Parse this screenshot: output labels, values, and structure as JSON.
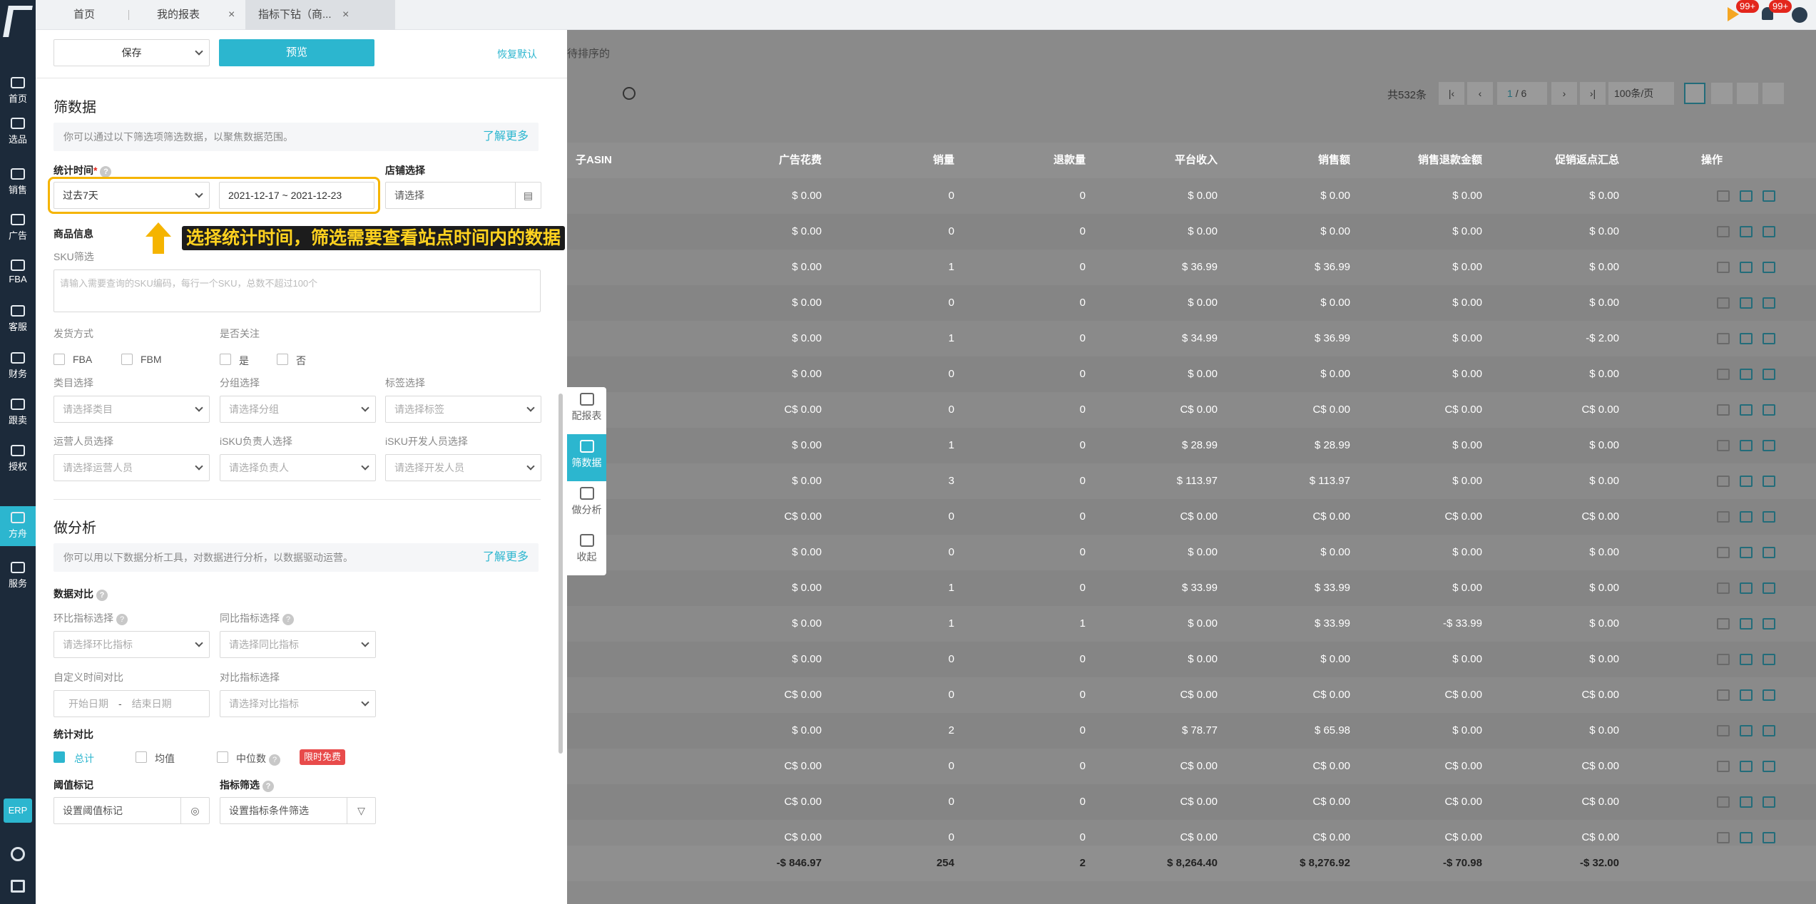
{
  "nav": {
    "items": [
      {
        "label": "首页"
      },
      {
        "label": "选品"
      },
      {
        "label": "销售"
      },
      {
        "label": "广告"
      },
      {
        "label": "FBA"
      },
      {
        "label": "客服"
      },
      {
        "label": "财务"
      },
      {
        "label": "跟卖"
      },
      {
        "label": "授权"
      },
      {
        "label": "方舟"
      },
      {
        "label": "服务"
      }
    ],
    "erp": "ERP"
  },
  "tabs": [
    {
      "label": "首页"
    },
    {
      "label": "我的报表"
    },
    {
      "label": "指标下钻（商..."
    }
  ],
  "badges": [
    "99+",
    "99+"
  ],
  "panel": {
    "save": "保存",
    "preview": "预览",
    "reset": "恢复默认",
    "filter": {
      "title": "筛数据",
      "note": "你可以通过以下筛选项筛选数据，以聚焦数据范围。",
      "more": "了解更多",
      "stat_time_label": "统计时间",
      "stat_time_value": "过去7天",
      "date_range": "2021-12-17  ~  2021-12-23",
      "shop_label": "店铺选择",
      "shop_placeholder": "请选择",
      "product_label": "商品信息",
      "sku_label": "SKU筛选",
      "sku_placeholder": "请输入需要查询的SKU编码，每行一个SKU，总数不超过100个",
      "ship_label": "发货方式",
      "fba": "FBA",
      "fbm": "FBM",
      "follow_label": "是否关注",
      "yes": "是",
      "no": "否",
      "cat_label": "类目选择",
      "cat_ph": "请选择类目",
      "group_label": "分组选择",
      "group_ph": "请选择分组",
      "tag_label": "标签选择",
      "tag_ph": "请选择标签",
      "ops_label": "运营人员选择",
      "ops_ph": "请选择运营人员",
      "owner_label": "iSKU负责人选择",
      "owner_ph": "请选择负责人",
      "dev_label": "iSKU开发人员选择",
      "dev_ph": "请选择开发人员"
    },
    "analysis": {
      "title": "做分析",
      "note": "你可以用以下数据分析工具，对数据进行分析，以数据驱动运营。",
      "more": "了解更多",
      "compare_label": "数据对比",
      "mom_label": "环比指标选择",
      "mom_ph": "请选择环比指标",
      "yoy_label": "同比指标选择",
      "yoy_ph": "请选择同比指标",
      "custom_label": "自定义时间对比",
      "start_ph": "开始日期",
      "end_ph": "结束日期",
      "cmp_label": "对比指标选择",
      "cmp_ph": "请选择对比指标",
      "stat_cmp_label": "统计对比",
      "total": "总计",
      "mean": "均值",
      "median": "中位数",
      "free_tag": "限时免费",
      "threshold_label": "阈值标记",
      "threshold_ph": "设置阈值标记",
      "metric_filter_label": "指标筛选",
      "metric_filter_ph": "设置指标条件筛选"
    }
  },
  "annotation": "选择统计时间，筛选需要查看站点时间内的数据",
  "rail": [
    {
      "label": "配报表"
    },
    {
      "label": "筛数据"
    },
    {
      "label": "做分析"
    },
    {
      "label": "收起"
    }
  ],
  "table": {
    "sort_hint": "待排序的",
    "total_label": "共532条",
    "page_current": "1",
    "page_total": "/ 6",
    "page_size": "100条/页",
    "headers": [
      "子ASIN",
      "广告花费",
      "销量",
      "退款量",
      "平台收入",
      "销售额",
      "销售退款金额",
      "促销返点汇总",
      "操作"
    ],
    "rows": [
      [
        "$ 0.00",
        "0",
        "0",
        "$ 0.00",
        "$ 0.00",
        "$ 0.00",
        "$ 0.00"
      ],
      [
        "$ 0.00",
        "0",
        "0",
        "$ 0.00",
        "$ 0.00",
        "$ 0.00",
        "$ 0.00"
      ],
      [
        "$ 0.00",
        "1",
        "0",
        "$ 36.99",
        "$ 36.99",
        "$ 0.00",
        "$ 0.00"
      ],
      [
        "$ 0.00",
        "0",
        "0",
        "$ 0.00",
        "$ 0.00",
        "$ 0.00",
        "$ 0.00"
      ],
      [
        "$ 0.00",
        "1",
        "0",
        "$ 34.99",
        "$ 36.99",
        "$ 0.00",
        "-$ 2.00"
      ],
      [
        "$ 0.00",
        "0",
        "0",
        "$ 0.00",
        "$ 0.00",
        "$ 0.00",
        "$ 0.00"
      ],
      [
        "C$ 0.00",
        "0",
        "0",
        "C$ 0.00",
        "C$ 0.00",
        "C$ 0.00",
        "C$ 0.00"
      ],
      [
        "$ 0.00",
        "1",
        "0",
        "$ 28.99",
        "$ 28.99",
        "$ 0.00",
        "$ 0.00"
      ],
      [
        "$ 0.00",
        "3",
        "0",
        "$ 113.97",
        "$ 113.97",
        "$ 0.00",
        "$ 0.00"
      ],
      [
        "C$ 0.00",
        "0",
        "0",
        "C$ 0.00",
        "C$ 0.00",
        "C$ 0.00",
        "C$ 0.00"
      ],
      [
        "$ 0.00",
        "0",
        "0",
        "$ 0.00",
        "$ 0.00",
        "$ 0.00",
        "$ 0.00"
      ],
      [
        "$ 0.00",
        "1",
        "0",
        "$ 33.99",
        "$ 33.99",
        "$ 0.00",
        "$ 0.00"
      ],
      [
        "$ 0.00",
        "1",
        "1",
        "$ 0.00",
        "$ 33.99",
        "-$ 33.99",
        "$ 0.00"
      ],
      [
        "$ 0.00",
        "0",
        "0",
        "$ 0.00",
        "$ 0.00",
        "$ 0.00",
        "$ 0.00"
      ],
      [
        "C$ 0.00",
        "0",
        "0",
        "C$ 0.00",
        "C$ 0.00",
        "C$ 0.00",
        "C$ 0.00"
      ],
      [
        "$ 0.00",
        "2",
        "0",
        "$ 78.77",
        "$ 65.98",
        "$ 0.00",
        "$ 0.00"
      ],
      [
        "C$ 0.00",
        "0",
        "0",
        "C$ 0.00",
        "C$ 0.00",
        "C$ 0.00",
        "C$ 0.00"
      ],
      [
        "C$ 0.00",
        "0",
        "0",
        "C$ 0.00",
        "C$ 0.00",
        "C$ 0.00",
        "C$ 0.00"
      ],
      [
        "C$ 0.00",
        "0",
        "0",
        "C$ 0.00",
        "C$ 0.00",
        "C$ 0.00",
        "C$ 0.00"
      ]
    ],
    "totals": [
      "-$ 846.97",
      "254",
      "2",
      "$ 8,264.40",
      "$ 8,276.92",
      "-$ 70.98",
      "-$ 32.00"
    ]
  },
  "colors": {
    "accent": "#2cb6cf",
    "sidebar": "#1c2a3a",
    "highlight": "#f5b400",
    "tag": "#e84b4b"
  }
}
